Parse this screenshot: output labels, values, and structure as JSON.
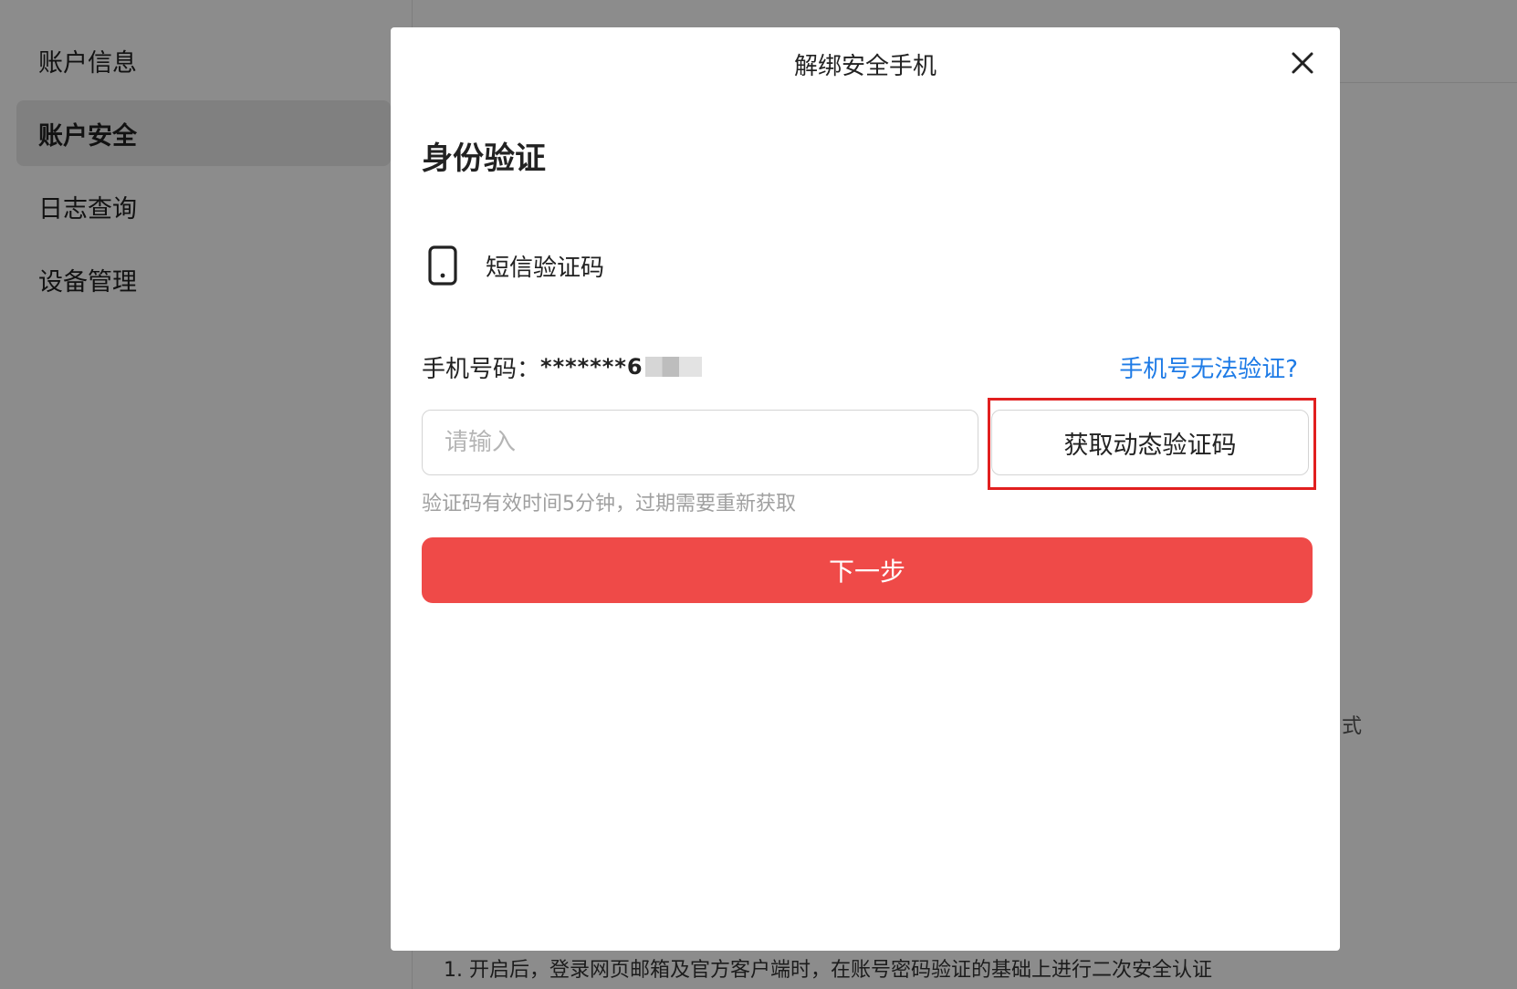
{
  "sidebar": {
    "items": [
      {
        "label": "账户信息",
        "active": false
      },
      {
        "label": "账户安全",
        "active": true
      },
      {
        "label": "日志查询",
        "active": false
      },
      {
        "label": "设备管理",
        "active": false
      }
    ]
  },
  "background": {
    "right_fragment": "式",
    "bottom_text": "1. 开启后，登录网页邮箱及官方客户端时，在账号密码验证的基础上进行二次安全认证"
  },
  "modal": {
    "title": "解绑安全手机",
    "close_icon": "close-icon",
    "section_title": "身份验证",
    "method": {
      "icon": "mobile-phone-icon",
      "label": "短信验证码"
    },
    "phone": {
      "label": "手机号码：",
      "value": "*******6"
    },
    "cant_verify_link": "手机号无法验证?",
    "code_input": {
      "placeholder": "请输入",
      "value": ""
    },
    "get_code_button": "获取动态验证码",
    "hint": "验证码有效时间5分钟，过期需要重新获取",
    "next_button": "下一步",
    "colors": {
      "primary": "#ef4a48",
      "link": "#1e7be6",
      "highlight": "#e11f1f"
    }
  }
}
